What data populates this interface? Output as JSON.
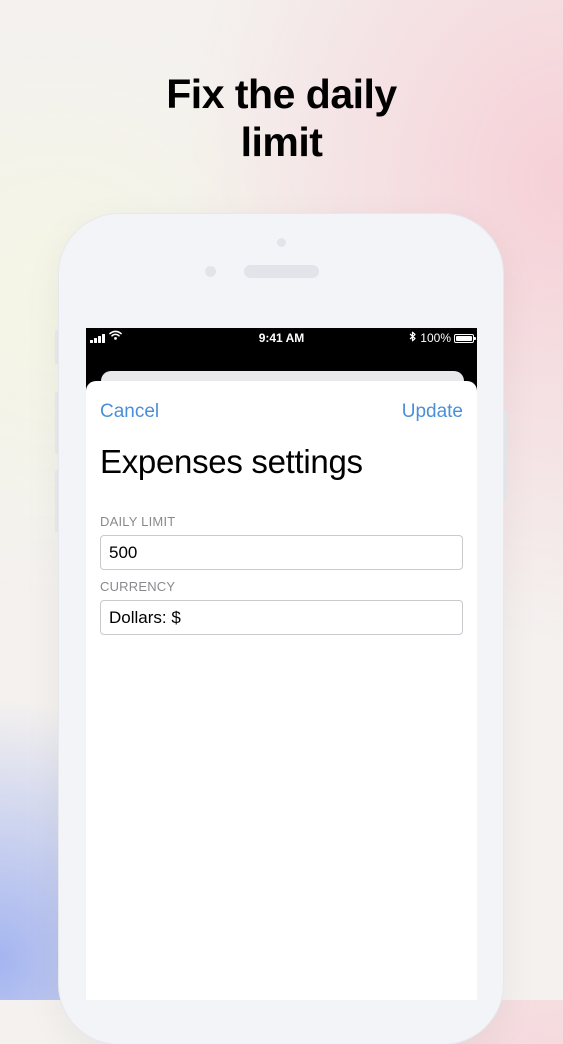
{
  "headline": {
    "line1": "Fix the daily",
    "line2": "limit"
  },
  "status_bar": {
    "time": "9:41 AM",
    "battery": "100%",
    "icons": [
      "signal-icon",
      "wifi-icon",
      "bluetooth-icon",
      "battery-icon"
    ]
  },
  "nav": {
    "cancel_label": "Cancel",
    "update_label": "Update",
    "accent_color": "#4a90d9"
  },
  "settings": {
    "title": "Expenses settings",
    "daily_limit": {
      "label": "DAILY LIMIT",
      "value": "500"
    },
    "currency": {
      "label": "CURRENCY",
      "value": "Dollars: $"
    }
  }
}
